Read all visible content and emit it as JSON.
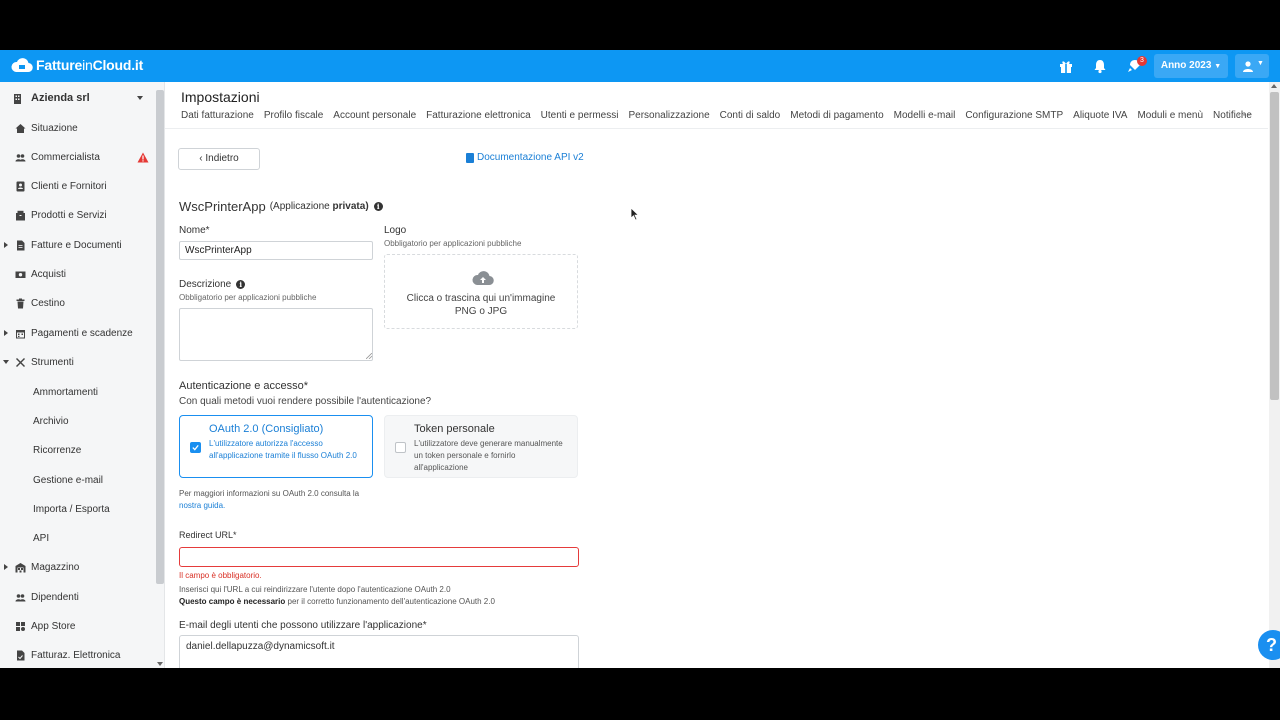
{
  "topbar": {
    "brand_bold": "Fatture",
    "brand_thin": "in",
    "brand_tail": "Cloud.it",
    "notification_count": "3",
    "year_label": "Anno 2023",
    "colors": {
      "bar": "#0d97f3",
      "badge": "#e53935"
    }
  },
  "sidebar": {
    "company": "Azienda srl",
    "items": [
      {
        "label": "Situazione",
        "icon": "home-icon"
      },
      {
        "label": "Commercialista",
        "icon": "users-icon"
      },
      {
        "label": "Clienti e Fornitori",
        "icon": "contacts-icon"
      },
      {
        "label": "Prodotti e Servizi",
        "icon": "box-icon"
      },
      {
        "label": "Fatture e Documenti",
        "icon": "document-icon"
      },
      {
        "label": "Acquisti",
        "icon": "cash-icon"
      },
      {
        "label": "Cestino",
        "icon": "trash-icon"
      },
      {
        "label": "Pagamenti e scadenze",
        "icon": "calendar-icon"
      },
      {
        "label": "Strumenti",
        "icon": "tools-icon"
      },
      {
        "label": "Ammortamenti"
      },
      {
        "label": "Archivio"
      },
      {
        "label": "Ricorrenze"
      },
      {
        "label": "Gestione e-mail"
      },
      {
        "label": "Importa / Esporta"
      },
      {
        "label": "API"
      },
      {
        "label": "Magazzino",
        "icon": "warehouse-icon"
      },
      {
        "label": "Dipendenti",
        "icon": "users-icon"
      },
      {
        "label": "App Store",
        "icon": "apps-icon"
      },
      {
        "label": "Fatturaz. Elettronica",
        "icon": "invoice-icon"
      }
    ]
  },
  "page": {
    "title": "Impostazioni",
    "tabs": [
      "Dati fatturazione",
      "Profilo fiscale",
      "Account personale",
      "Fatturazione elettronica",
      "Utenti e permessi",
      "Personalizzazione",
      "Conti di saldo",
      "Metodi di pagamento",
      "Modelli e-mail",
      "Configurazione SMTP",
      "Aliquote IVA",
      "Moduli e menù",
      "Notifiche"
    ],
    "tabs_more": "···",
    "back_label": "‹ Indietro",
    "doc_link": "Documentazione API v2"
  },
  "form": {
    "app_name": "WscPrinterApp",
    "app_type_pre": "(Applicazione",
    "app_type_bold": "privata)",
    "name_label": "Nome*",
    "name_value": "WscPrinterApp",
    "logo_label": "Logo",
    "logo_hint": "Obbligatorio per applicazioni pubbliche",
    "logo_drop_line1": "Clicca o trascina qui un'immagine",
    "logo_drop_line2": "PNG o JPG",
    "desc_label": "Descrizione",
    "desc_hint": "Obbligatorio per applicazioni pubbliche",
    "auth_title": "Autenticazione e accesso*",
    "auth_subtitle": "Con quali metodi vuoi rendere possibile l'autenticazione?",
    "oauth_title": "OAuth 2.0 (Consigliato)",
    "oauth_desc": "L'utilizzatore autorizza l'accesso all'applicazione tramite il flusso OAuth 2.0",
    "token_title": "Token personale",
    "token_desc": "L'utilizzatore deve generare manualmente un token personale e fornirlo all'applicazione",
    "oauth_checked": true,
    "token_checked": false,
    "oauth_info_pre": "Per maggiori informazioni su OAuth 2.0 consulta la",
    "oauth_info_link": "nostra guida.",
    "redirect_label": "Redirect URL*",
    "redirect_value": "",
    "redirect_error": "Il campo è obbligatorio.",
    "redirect_hint1": "Inserisci qui l'URL a cui reindirizzare l'utente dopo l'autenticazione OAuth 2.0",
    "redirect_hint2_bold": "Questo campo è necessario",
    "redirect_hint2_rest": "per il corretto funzionamento dell'autenticazione OAuth 2.0",
    "email_label": "E-mail degli utenti che possono utilizzare l'applicazione*",
    "email_value": "daniel.dellapuzza@dynamicsoft.it"
  },
  "help": {
    "label": "?"
  }
}
